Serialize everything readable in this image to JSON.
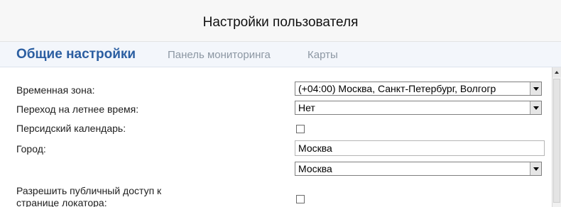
{
  "header": {
    "title": "Настройки пользователя"
  },
  "tabs": [
    {
      "label": "Общие настройки",
      "active": true
    },
    {
      "label": "Панель мониторинга",
      "active": false
    },
    {
      "label": "Карты",
      "active": false
    }
  ],
  "form": {
    "timezone": {
      "label": "Временная зона:",
      "value": "(+04:00) Москва, Санкт-Петербург, Волгогр"
    },
    "dst": {
      "label": "Переход на летнее время:",
      "value": "Нет"
    },
    "persian_calendar": {
      "label": "Персидский календарь:",
      "checked": false
    },
    "city": {
      "label": "Город:",
      "input_value": "Москва",
      "select_value": "Москва"
    },
    "public_access": {
      "label_line1": "Разрешить публичный доступ к",
      "label_line2": "странице локатора:",
      "checked": false
    }
  },
  "icons": {
    "dropdown_arrow": "chevron-down-icon",
    "scroll_up": "scroll-up-icon"
  }
}
